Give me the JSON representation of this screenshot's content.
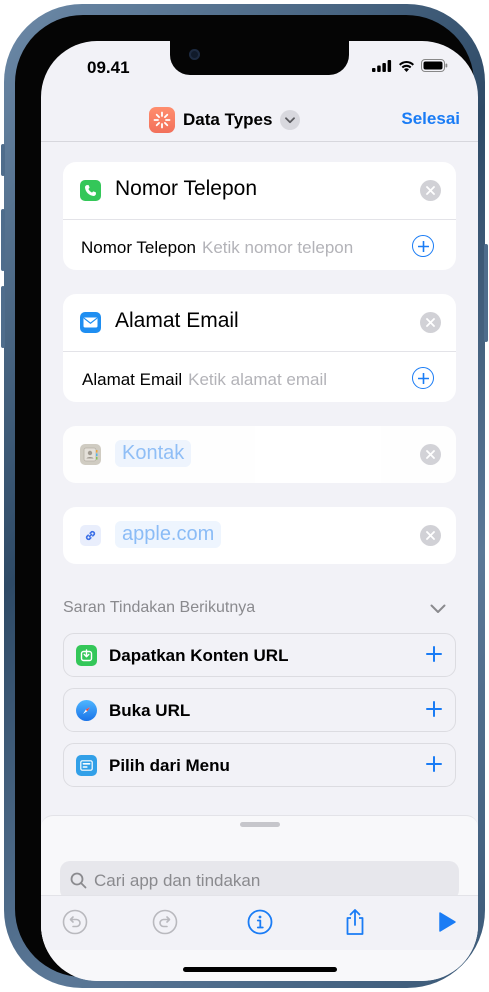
{
  "status": {
    "time": "09.41"
  },
  "nav": {
    "title": "Data Types",
    "done": "Selesai"
  },
  "cards": {
    "phone": {
      "title": "Nomor Telepon",
      "param_label": "Nomor Telepon",
      "param_placeholder": "Ketik nomor telepon"
    },
    "email": {
      "title": "Alamat Email",
      "param_label": "Alamat Email",
      "param_placeholder": "Ketik alamat email"
    },
    "contacts": {
      "token": "Kontak"
    },
    "url": {
      "token": "apple.com"
    }
  },
  "suggestions": {
    "header": "Saran Tindakan Berikutnya",
    "items": [
      {
        "label": "Dapatkan Konten URL"
      },
      {
        "label": "Buka URL"
      },
      {
        "label": "Pilih dari Menu"
      }
    ]
  },
  "search": {
    "placeholder": "Cari app dan tindakan"
  },
  "colors": {
    "accent": "#1a7cf5",
    "phone_green": "#34c759",
    "mail_blue": "#1f8ef1",
    "app_icon": "#f47a5e"
  }
}
